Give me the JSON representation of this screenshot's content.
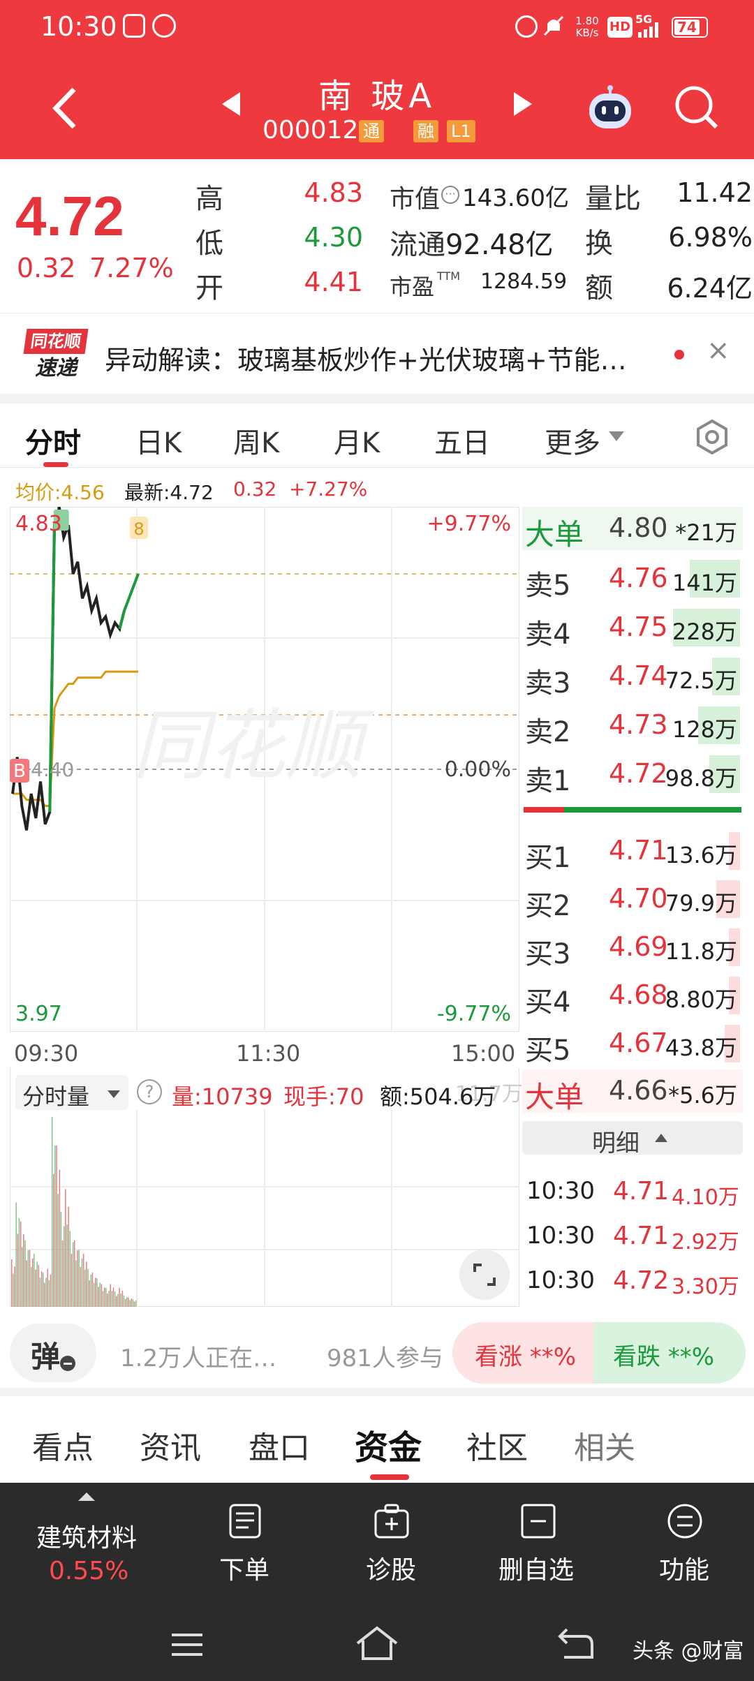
{
  "status": {
    "time": "10:30",
    "net_speed_top": "1.80",
    "net_speed_bottom": "KB/s",
    "hd": "HD",
    "signal": "5G",
    "battery": "74"
  },
  "header": {
    "name": "南 玻A",
    "code": "000012",
    "tag_tong": "通",
    "tag_rong": "融",
    "tag_level": "L1"
  },
  "quote": {
    "price": "4.72",
    "change": "0.32",
    "pct": "7.27%",
    "high_label": "高",
    "high": "4.83",
    "low_label": "低",
    "low": "4.30",
    "open_label": "开",
    "open": "4.41",
    "mktcap_label": "市值",
    "mktcap": "143.60亿",
    "float_label": "流通",
    "float": "92.48亿",
    "pe_label": "市盈",
    "pe_tm": "TTM",
    "pe": "1284.59",
    "vol_ratio_label": "量比",
    "vol_ratio": "11.42",
    "turnover_label": "换",
    "turnover": "6.98%",
    "amount_label": "额",
    "amount": "6.24亿"
  },
  "anomaly": {
    "logo_top": "同花顺",
    "logo_bottom": "速递",
    "text": "异动解读：玻璃基板炒作+光伏玻璃+节能…",
    "close": "×"
  },
  "chart_tabs": [
    "分时",
    "日K",
    "周K",
    "月K",
    "五日",
    "更多"
  ],
  "chart_info": {
    "avg_label": "均价:4.56",
    "latest_label": "最新:4.72",
    "change": "0.32",
    "pct": "+7.27%"
  },
  "chart_data": {
    "type": "line",
    "y_max_label": "4.83",
    "y_min_label": "3.97",
    "y_mid_label": "4.40",
    "pct_max": "+9.77%",
    "pct_min": "-9.77%",
    "pct_mid": "0.00%",
    "x_labels": [
      "09:30",
      "11:30",
      "15:00"
    ],
    "ylim": [
      3.97,
      4.83
    ],
    "prev_close": 4.4,
    "marker_b": "B",
    "marker_s": "8",
    "watermark": "同花顺",
    "series": [
      {
        "values": [
          4.36,
          4.42,
          4.34,
          4.3,
          4.36,
          4.32,
          4.38,
          4.31,
          4.33,
          4.8,
          4.83,
          4.78,
          4.8,
          4.72,
          4.74,
          4.68,
          4.7,
          4.66,
          4.68,
          4.64,
          4.65,
          4.62,
          4.64,
          4.63,
          4.66,
          4.68,
          4.7,
          4.72
        ]
      },
      {
        "values": [
          4.36,
          4.36,
          4.36,
          4.35,
          4.35,
          4.35,
          4.35,
          4.34,
          4.34,
          4.5,
          4.52,
          4.53,
          4.54,
          4.54,
          4.55,
          4.55,
          4.55,
          4.55,
          4.55,
          4.55,
          4.56,
          4.56,
          4.56,
          4.56,
          4.56,
          4.56,
          4.56,
          4.56
        ]
      }
    ]
  },
  "order_book": {
    "big_sell": {
      "label": "大单",
      "price": "4.80",
      "vol": "*21万"
    },
    "asks": [
      {
        "label": "卖5",
        "price": "4.76",
        "vol": "141万",
        "level": 0.35
      },
      {
        "label": "卖4",
        "price": "4.75",
        "vol": "228万",
        "level": 0.55
      },
      {
        "label": "卖3",
        "price": "4.74",
        "vol": "72.5万",
        "level": 0.08
      },
      {
        "label": "卖2",
        "price": "4.73",
        "vol": "128万",
        "level": 0.25
      },
      {
        "label": "卖1",
        "price": "4.72",
        "vol": "98.8万",
        "level": 0.12
      }
    ],
    "bids": [
      {
        "label": "买1",
        "price": "4.71",
        "vol": "13.6万",
        "level": 0.02
      },
      {
        "label": "买2",
        "price": "4.70",
        "vol": "79.9万",
        "level": 0.08
      },
      {
        "label": "买3",
        "price": "4.69",
        "vol": "11.8万",
        "level": 0.02
      },
      {
        "label": "买4",
        "price": "4.68",
        "vol": "8.80万",
        "level": 0.02
      },
      {
        "label": "买5",
        "price": "4.67",
        "vol": "43.8万",
        "level": 0.04
      }
    ],
    "big_buy": {
      "label": "大单",
      "price": "4.66",
      "vol": "*5.6万"
    },
    "detail_label": "明细",
    "ticks": [
      {
        "time": "10:30",
        "price": "4.71",
        "vol": "4.10万"
      },
      {
        "time": "10:30",
        "price": "4.71",
        "vol": "2.92万"
      },
      {
        "time": "10:30",
        "price": "4.72",
        "vol": "3.30万"
      }
    ]
  },
  "volume": {
    "selector": "分时量",
    "vol": "量:10739",
    "now": "现手:70",
    "amount": "额:504.6万",
    "scale": "11.7万",
    "bars": [
      0.25,
      0.55,
      0.45,
      0.35,
      0.3,
      0.28,
      0.22,
      0.18,
      0.2,
      1.0,
      0.85,
      0.5,
      0.62,
      0.4,
      0.35,
      0.3,
      0.28,
      0.2,
      0.18,
      0.15,
      0.12,
      0.1,
      0.12,
      0.08,
      0.1,
      0.06,
      0.05,
      0.04
    ]
  },
  "sentiment": {
    "danmu": "弹",
    "watching": "1.2万人正在…",
    "participants": "981人参与",
    "rise": "看涨 **%",
    "fall": "看跌 **%"
  },
  "bottom_tabs": [
    "看点",
    "资讯",
    "盘口",
    "资金",
    "社区",
    "相关"
  ],
  "action_bar": {
    "sector": "建筑材料",
    "sector_pct": "0.55%",
    "order": "下单",
    "diagnose": "诊股",
    "remove": "删自选",
    "function": "功能"
  },
  "watermark": "头条 @财富"
}
